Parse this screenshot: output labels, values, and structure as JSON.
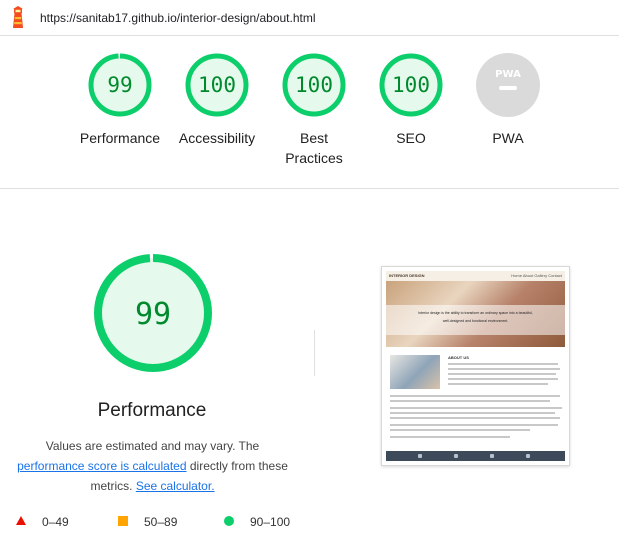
{
  "header": {
    "url": "https://sanitab17.github.io/interior-design/about.html",
    "logo_icon": "lighthouse-icon"
  },
  "categories": [
    {
      "id": "performance",
      "score": "99",
      "label": "Performance",
      "score_value": 99
    },
    {
      "id": "accessibility",
      "score": "100",
      "label": "Accessibility",
      "score_value": 100
    },
    {
      "id": "best-practices",
      "score": "100",
      "label": "Best Practices",
      "score_value": 100
    },
    {
      "id": "seo",
      "score": "100",
      "label": "SEO",
      "score_value": 100
    },
    {
      "id": "pwa",
      "label": "PWA",
      "badge": "PWA"
    }
  ],
  "main": {
    "score": "99",
    "score_value": 99,
    "title": "Performance",
    "note_prefix": "Values are estimated and may vary. The",
    "note_link": "performance score is calculated",
    "note_middle": "directly from these metrics.",
    "note_link2": "See calculator."
  },
  "thumbnail": {
    "brand": "INTERIOR DESIGN",
    "nav_links": "Home  About  Gallery  Contact",
    "hero_text_1": "Interior design is the ability to transform an ordinary space into a beautiful,",
    "hero_text_2": "well-designed and functional environment.",
    "about_title": "ABOUT US"
  },
  "legend": [
    {
      "range": "0–49",
      "icon": "fail-triangle-icon"
    },
    {
      "range": "50–89",
      "icon": "average-square-icon"
    },
    {
      "range": "90–100",
      "icon": "pass-circle-icon"
    }
  ],
  "colors": {
    "pass": "#0cce6b",
    "pass_fill": "#e6f9ed",
    "pass_text": "#008a2d",
    "average": "#ffa400",
    "fail": "#eb0f00",
    "pwa_gray": "#dadada",
    "link": "#1a73e8"
  }
}
